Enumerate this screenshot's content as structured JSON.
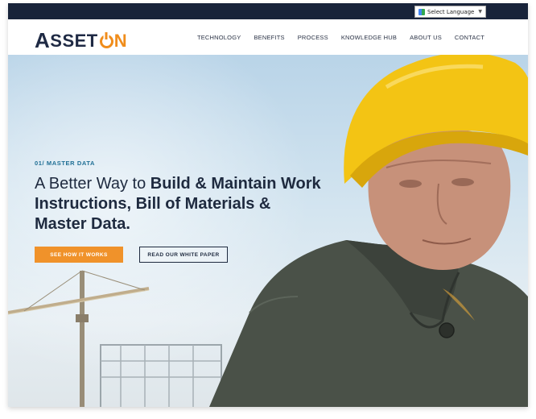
{
  "topbar": {
    "language_select": "Select Language",
    "language_caret": "▼"
  },
  "brand": {
    "logo_prefix": "A",
    "logo_middle": "SSET",
    "logo_suffix": "N",
    "accent_color": "#f08d1c",
    "navy_color": "#1f2a44"
  },
  "nav": {
    "items": [
      {
        "label": "TECHNOLOGY"
      },
      {
        "label": "BENEFITS"
      },
      {
        "label": "PROCESS"
      },
      {
        "label": "KNOWLEDGE HUB"
      },
      {
        "label": "ABOUT US"
      },
      {
        "label": "CONTACT"
      }
    ]
  },
  "hero": {
    "eyebrow": "01/ MASTER DATA",
    "headline_light": "A Better Way to ",
    "headline_bold": "Build & Maintain Work Instructions, Bill of Materials & Master Data.",
    "cta_primary": "SEE HOW IT WORKS",
    "cta_secondary": "READ OUR WHITE PAPER"
  }
}
